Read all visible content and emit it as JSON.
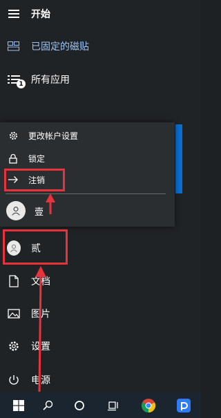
{
  "start_menu": {
    "header": {
      "label": "开始"
    },
    "pinned": {
      "label": "已固定的磁贴"
    },
    "all_apps": {
      "label": "所有应用",
      "badge": "1"
    },
    "user_flyout": {
      "items": [
        {
          "label": "更改帐户设置",
          "icon": "gear-icon"
        },
        {
          "label": "锁定",
          "icon": "lock-icon"
        },
        {
          "label": "注销",
          "icon": "sign-out-icon"
        }
      ],
      "current_user": {
        "name": "壹"
      }
    },
    "other_user": {
      "name": "贰"
    },
    "documents": {
      "label": "文档"
    },
    "pictures": {
      "label": "图片"
    },
    "settings": {
      "label": "设置"
    },
    "power": {
      "label": "电源"
    }
  },
  "colors": {
    "highlight": "#e8323c",
    "accent_tile": "#0a6fd0",
    "menu_bg": "#202326"
  },
  "taskbar": {
    "icons": [
      "windows-start-icon",
      "search-icon",
      "cortana-icon",
      "task-view-icon",
      "chrome-icon",
      "pinned-app-icon"
    ]
  }
}
